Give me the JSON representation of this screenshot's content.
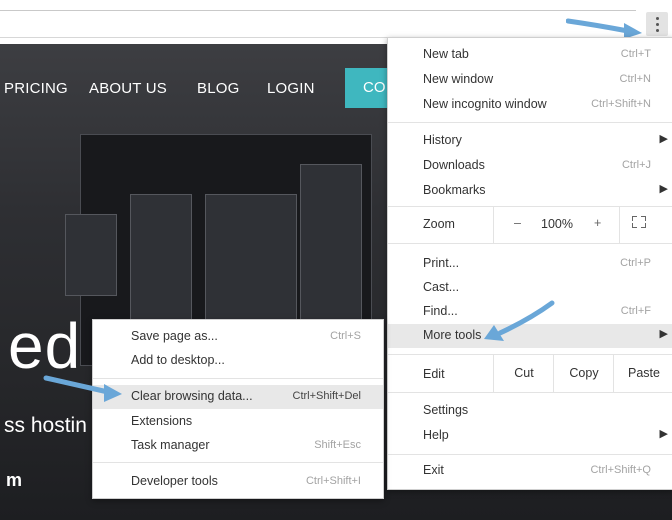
{
  "site": {
    "nav": [
      "PRICING",
      "ABOUT US",
      "BLOG",
      "LOGIN"
    ],
    "contact_label": "CO",
    "hero_title": "ed",
    "hero_sub": "ss hostin",
    "hero_small": "m"
  },
  "main_menu": {
    "new_tab": {
      "label": "New tab",
      "shortcut": "Ctrl+T"
    },
    "new_window": {
      "label": "New window",
      "shortcut": "Ctrl+N"
    },
    "new_incognito": {
      "label": "New incognito window",
      "shortcut": "Ctrl+Shift+N"
    },
    "history": {
      "label": "History"
    },
    "downloads": {
      "label": "Downloads",
      "shortcut": "Ctrl+J"
    },
    "bookmarks": {
      "label": "Bookmarks"
    },
    "zoom": {
      "label": "Zoom",
      "minus": "–",
      "value": "100%",
      "plus": "+"
    },
    "print": {
      "label": "Print...",
      "shortcut": "Ctrl+P"
    },
    "cast": {
      "label": "Cast..."
    },
    "find": {
      "label": "Find...",
      "shortcut": "Ctrl+F"
    },
    "more_tools": {
      "label": "More tools"
    },
    "edit": {
      "label": "Edit",
      "cut": "Cut",
      "copy": "Copy",
      "paste": "Paste"
    },
    "settings": {
      "label": "Settings"
    },
    "help": {
      "label": "Help"
    },
    "exit": {
      "label": "Exit",
      "shortcut": "Ctrl+Shift+Q"
    }
  },
  "sub_menu": {
    "save_page": {
      "label": "Save page as...",
      "shortcut": "Ctrl+S"
    },
    "add_desktop": {
      "label": "Add to desktop..."
    },
    "clear_data": {
      "label": "Clear browsing data...",
      "shortcut": "Ctrl+Shift+Del"
    },
    "extensions": {
      "label": "Extensions"
    },
    "task_manager": {
      "label": "Task manager",
      "shortcut": "Shift+Esc"
    },
    "dev_tools": {
      "label": "Developer tools",
      "shortcut": "Ctrl+Shift+I"
    }
  },
  "colors": {
    "accent": "#3fb7bf",
    "arrow": "#6aa7d8",
    "highlight": "#e8e8e8"
  }
}
